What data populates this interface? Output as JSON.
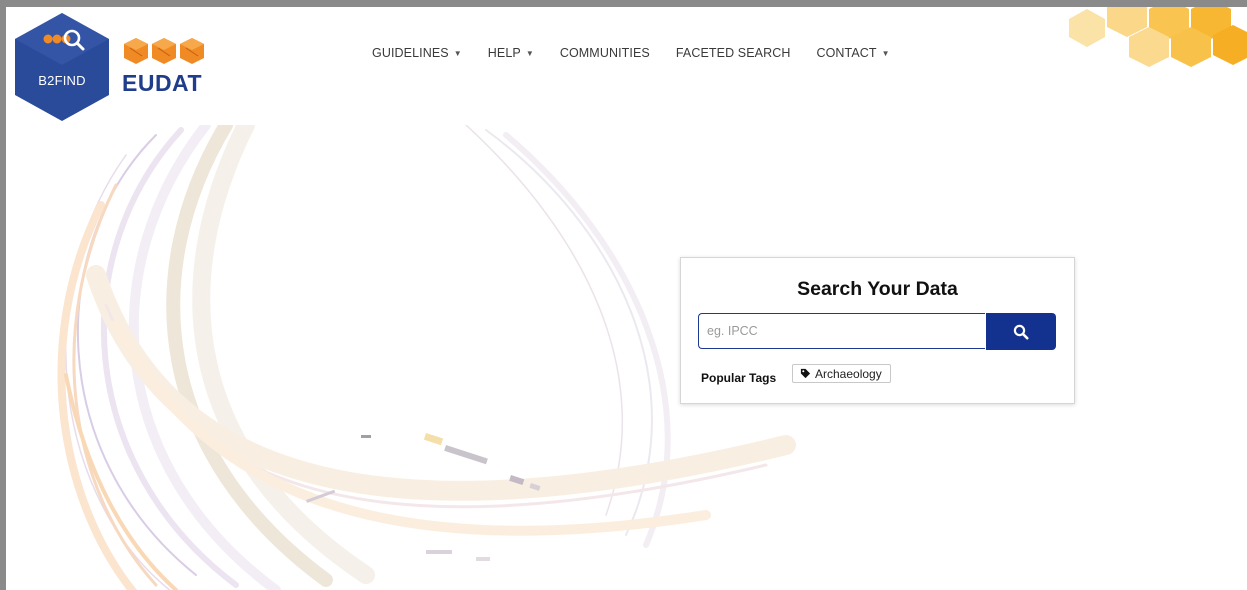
{
  "brand": {
    "b2find_label": "B2FIND",
    "eudat_label": "EUDAT",
    "colors": {
      "navy": "#1f3d8a",
      "hex_blue": "#2a4a9a",
      "orange": "#f08a24",
      "honey": "#f6b73c"
    }
  },
  "nav": {
    "items": [
      {
        "label": "GUIDELINES",
        "has_caret": true
      },
      {
        "label": "HELP",
        "has_caret": true
      },
      {
        "label": "COMMUNITIES",
        "has_caret": false
      },
      {
        "label": "FACETED SEARCH",
        "has_caret": false
      },
      {
        "label": "CONTACT",
        "has_caret": true
      }
    ],
    "caret_glyph": "▼"
  },
  "search": {
    "title": "Search Your Data",
    "placeholder": "eg. IPCC",
    "button_icon": "search-icon",
    "button_color": "#13318f"
  },
  "popular_tags": {
    "label": "Popular Tags",
    "tags": [
      {
        "label": "Archaeology",
        "icon": "tag-icon"
      }
    ]
  }
}
